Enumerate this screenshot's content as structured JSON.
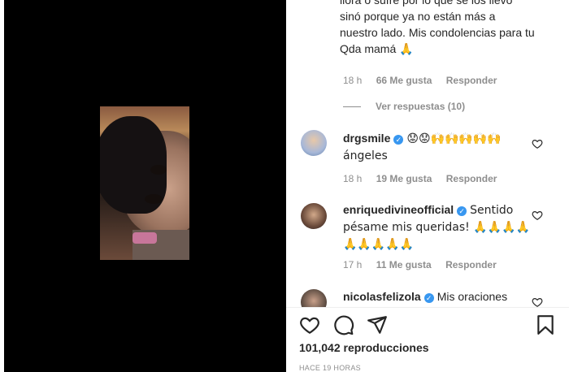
{
  "caption_tail": {
    "text": "llora o sufre por lo que se los llevó sinó porque ya no están más a nuestro lado. Mis condolencias para tu Qda mamá 🙏",
    "time": "18 h",
    "likes": "66 Me gusta",
    "reply": "Responder"
  },
  "view_replies": "Ver respuestas (10)",
  "comments": [
    {
      "username": "drgsmile",
      "text": "😟😟🙌🙌🙌🙌🙌 ángeles",
      "time": "18 h",
      "likes": "19 Me gusta",
      "reply": "Responder"
    },
    {
      "username": "enriquedivineofficial",
      "text": "Sentido pésame mis queridas! 🙏🙏🙏🙏 🙏🙏🙏🙏🙏",
      "time": "17 h",
      "likes": "11 Me gusta",
      "reply": "Responder"
    },
    {
      "username": "nicolasfelizola",
      "text": "Mis oraciones"
    }
  ],
  "actions": {
    "like_icon": "heart-icon",
    "comment_icon": "comment-icon",
    "share_icon": "paper-plane-icon",
    "save_icon": "bookmark-icon"
  },
  "views": "101,042 reproducciones",
  "posted_ago": "HACE 19 HORAS",
  "colors": {
    "text": "#262626",
    "muted": "#8e8e8e",
    "verified": "#3897f0",
    "media_bg": "#000000"
  }
}
